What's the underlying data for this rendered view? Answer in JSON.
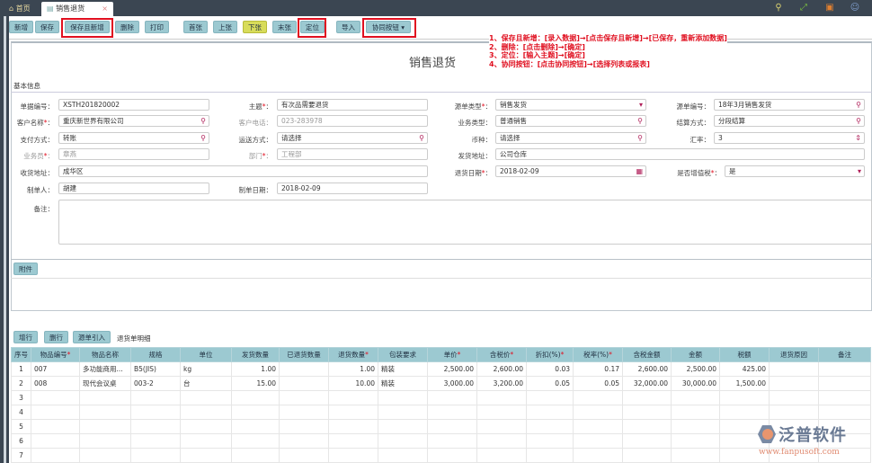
{
  "tabs": {
    "home": "首页",
    "active": "销售退货",
    "close": "×"
  },
  "toolbar": {
    "buttons": [
      "新增",
      "保存",
      "保存且新增",
      "删除",
      "打印",
      "首张",
      "上张",
      "下张",
      "末张",
      "定位",
      "导入",
      "协同按钮 ▾"
    ]
  },
  "page_title": "销售退货",
  "instructions": [
    "1、保存且新增：[录入数据]→[点击保存且新增]→[已保存，重新添加数据]",
    "2、删除：[点击删除]→[确定]",
    "3、定位：[输入主题]→[确定]",
    "4、协同按钮：[点击协同按钮]→[选择列表或报表]"
  ],
  "section_basic": "基本信息",
  "fields": {
    "doc_no": {
      "label": "单据编号：",
      "value": "XSTH201820002"
    },
    "subject": {
      "label": "主题",
      "value": "有次品需要退货"
    },
    "source_type": {
      "label": "源单类型",
      "value": "销售发货"
    },
    "source_no": {
      "label": "源单编号：",
      "value": "18年3月销售发货"
    },
    "customer": {
      "label": "客户名称",
      "value": "重庆新世界有限公司"
    },
    "phone": {
      "label": "客户电话：",
      "value": "023-283978"
    },
    "biz_type": {
      "label": "业务类型：",
      "value": "普通销售"
    },
    "settle": {
      "label": "结算方式：",
      "value": "分段结算"
    },
    "pay": {
      "label": "支付方式：",
      "value": "转账"
    },
    "ship": {
      "label": "运送方式：",
      "value": "请选择"
    },
    "currency": {
      "label": "币种：",
      "value": "请选择"
    },
    "rate": {
      "label": "汇率：",
      "value": "3"
    },
    "salesman": {
      "label": "业务员",
      "value": "章燕"
    },
    "dept": {
      "label": "部门",
      "value": "工程部"
    },
    "ship_addr": {
      "label": "发货地址：",
      "value": "公司仓库"
    },
    "recv_addr": {
      "label": "收货地址：",
      "value": "成华区"
    },
    "return_date": {
      "label": "退货日期",
      "value": "2018-02-09"
    },
    "vat": {
      "label": "是否增值税",
      "value": "是"
    },
    "maker": {
      "label": "制单人：",
      "value": "胡建"
    },
    "make_date": {
      "label": "制单日期：",
      "value": "2018-02-09"
    },
    "remark": {
      "label": "备注："
    }
  },
  "attach_label": "附件",
  "detail": {
    "buttons": [
      "增行",
      "删行",
      "源单引入"
    ],
    "caption": "退货单明细",
    "headers": [
      "序号",
      "物品编号",
      "物品名称",
      "规格",
      "单位",
      "发货数量",
      "已退货数量",
      "退货数量",
      "包装要求",
      "单价",
      "含税价",
      "折扣(%)",
      "税率(%)",
      "含税金额",
      "金额",
      "税额",
      "退货原因",
      "备注"
    ],
    "rows": [
      [
        "1",
        "007",
        "多功能商用...",
        "B5(JIS)",
        "kg",
        "1.00",
        "",
        "1.00",
        "精装",
        "2,500.00",
        "2,600.00",
        "0.03",
        "0.17",
        "2,600.00",
        "2,500.00",
        "425.00",
        "",
        ""
      ],
      [
        "2",
        "008",
        "现代会议桌",
        "003-2",
        "台",
        "15.00",
        "",
        "10.00",
        "精装",
        "3,000.00",
        "3,200.00",
        "0.05",
        "0.05",
        "32,000.00",
        "30,000.00",
        "1,500.00",
        "",
        ""
      ],
      [
        "3"
      ],
      [
        "4"
      ],
      [
        "5"
      ],
      [
        "6"
      ],
      [
        "7"
      ]
    ]
  },
  "logo": {
    "name": "泛普软件",
    "url": "www.fanpusoft.com"
  }
}
